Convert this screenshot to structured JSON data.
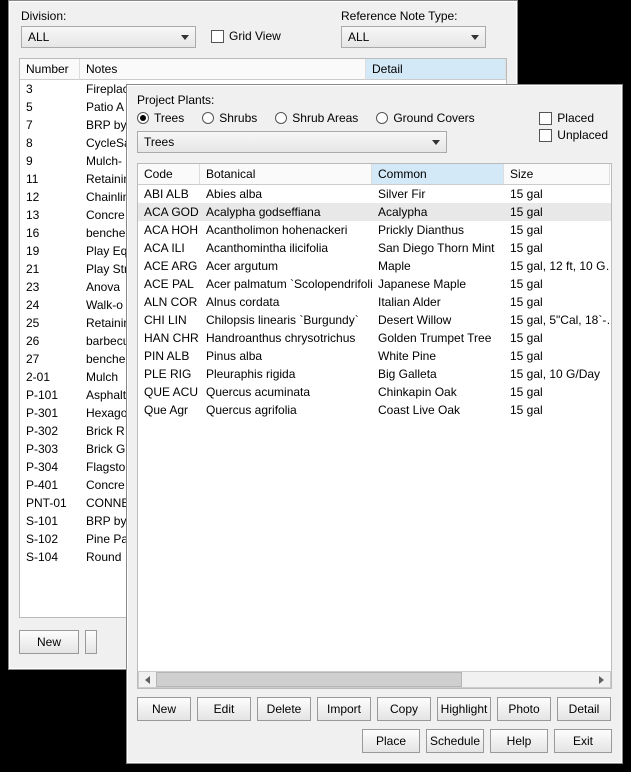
{
  "back": {
    "division_label": "Division:",
    "division_value": "ALL",
    "gridview_label": "Grid View",
    "refnote_label": "Reference Note Type:",
    "refnote_value": "ALL",
    "columns": {
      "number": "Number",
      "notes": "Notes",
      "detail": "Detail"
    },
    "rows": [
      {
        "num": "3",
        "notes": "Fireplac"
      },
      {
        "num": "5",
        "notes": "Patio A"
      },
      {
        "num": "7",
        "notes": "BRP by"
      },
      {
        "num": "8",
        "notes": "CycleSa"
      },
      {
        "num": "9",
        "notes": "Mulch-"
      },
      {
        "num": "11",
        "notes": "Retainin"
      },
      {
        "num": "12",
        "notes": "Chainlin"
      },
      {
        "num": "13",
        "notes": "Concre"
      },
      {
        "num": "16",
        "notes": "benche"
      },
      {
        "num": "19",
        "notes": "Play Eq"
      },
      {
        "num": "21",
        "notes": "Play Str"
      },
      {
        "num": "23",
        "notes": "Anova"
      },
      {
        "num": "24",
        "notes": "Walk-o"
      },
      {
        "num": "25",
        "notes": "Retainin"
      },
      {
        "num": "26",
        "notes": "barbecu"
      },
      {
        "num": "27",
        "notes": "benche"
      },
      {
        "num": "2-01",
        "notes": "Mulch"
      },
      {
        "num": "P-101",
        "notes": "Asphalt"
      },
      {
        "num": "P-301",
        "notes": "Hexago"
      },
      {
        "num": "P-302",
        "notes": "Brick R"
      },
      {
        "num": "P-303",
        "notes": "Brick G"
      },
      {
        "num": "P-304",
        "notes": "Flagsto"
      },
      {
        "num": "P-401",
        "notes": "Concre"
      },
      {
        "num": "PNT-01",
        "notes": "CONNE"
      },
      {
        "num": "S-101",
        "notes": "BRP by"
      },
      {
        "num": "S-102",
        "notes": "Pine Pa"
      },
      {
        "num": "S-104",
        "notes": "Round"
      }
    ],
    "buttons": {
      "new": "New"
    }
  },
  "front": {
    "title": "Project Plants:",
    "tabs": {
      "trees": "Trees",
      "shrubs": "Shrubs",
      "shrub_areas": "Shrub Areas",
      "ground_covers": "Ground Covers"
    },
    "selected_tab": "trees",
    "combo_value": "Trees",
    "checks": {
      "placed": "Placed",
      "unplaced": "Unplaced"
    },
    "columns": {
      "code": "Code",
      "botanical": "Botanical",
      "common": "Common",
      "size": "Size"
    },
    "rows": [
      {
        "code": "ABI ALB",
        "bot": "Abies alba",
        "common": "Silver Fir",
        "size": "15 gal"
      },
      {
        "code": "ACA GOD",
        "bot": "Acalypha godseffiana",
        "common": "Acalypha",
        "size": "15 gal",
        "selected": true
      },
      {
        "code": "ACA HOH",
        "bot": "Acantholimon hohenackeri",
        "common": "Prickly Dianthus",
        "size": "15 gal"
      },
      {
        "code": "ACA ILI",
        "bot": "Acanthomintha ilicifolia",
        "common": "San Diego Thorn Mint",
        "size": "15 gal"
      },
      {
        "code": "ACE ARG",
        "bot": "Acer argutum",
        "common": "Maple",
        "size": "15 gal, 12 ft, 10 G…"
      },
      {
        "code": "ACE PAL",
        "bot": "Acer palmatum `Scolopendrifolium`",
        "common": "Japanese Maple",
        "size": "15 gal"
      },
      {
        "code": "ALN COR",
        "bot": "Alnus cordata",
        "common": "Italian Alder",
        "size": "15 gal"
      },
      {
        "code": "CHI LIN",
        "bot": "Chilopsis linearis `Burgundy`",
        "common": "Desert Willow",
        "size": "15 gal, 5\"Cal, 18`-…"
      },
      {
        "code": "HAN CHR",
        "bot": "Handroanthus chrysotrichus",
        "common": "Golden Trumpet Tree",
        "size": "15 gal"
      },
      {
        "code": "PIN ALB",
        "bot": "Pinus alba",
        "common": "White Pine",
        "size": "15 gal"
      },
      {
        "code": "PLE RIG",
        "bot": "Pleuraphis rigida",
        "common": "Big Galleta",
        "size": "15 gal, 10 G/Day"
      },
      {
        "code": "QUE ACU",
        "bot": "Quercus acuminata",
        "common": "Chinkapin Oak",
        "size": "15 gal"
      },
      {
        "code": "Que Agr",
        "bot": "Quercus agrifolia",
        "common": "Coast Live Oak",
        "size": "15 gal"
      }
    ],
    "buttons1": {
      "new": "New",
      "edit": "Edit",
      "delete": "Delete",
      "import": "Import",
      "copy": "Copy",
      "highlight": "Highlight",
      "photo": "Photo",
      "detail": "Detail"
    },
    "buttons2": {
      "place": "Place",
      "schedule": "Schedule",
      "help": "Help",
      "exit": "Exit"
    }
  }
}
